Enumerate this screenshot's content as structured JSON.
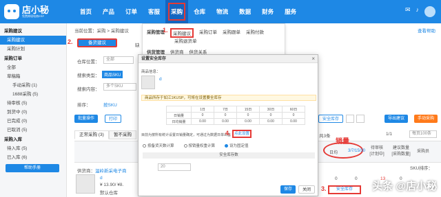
{
  "app": {
    "name": "店小秘",
    "subtitle": "免费跨境电商ERP"
  },
  "nav": [
    "首页",
    "产品",
    "订单",
    "客服",
    "采购",
    "仓库",
    "物流",
    "数据",
    "财务",
    "服务"
  ],
  "sidebar": {
    "groups": [
      {
        "title": "采购建议",
        "items": [
          "采购建议",
          "采购计划"
        ]
      },
      {
        "title": "采购订单",
        "items": [
          "全部",
          "草稿箱",
          "手动采购 (1)",
          "1688采购 (5)",
          "待审核 (5)",
          "到货中 (0)",
          "已完成 (0)",
          "已取消 (5)"
        ]
      },
      {
        "title": "采购入库",
        "items": [
          "待入库 (5)",
          "已入库 (6)"
        ]
      }
    ],
    "help_button": "帮助手册"
  },
  "breadcrumb": "当前位置：采购 > 采购建议",
  "help_link": "查看帮助",
  "purchase_dropdown": {
    "row1": {
      "label": "采购管理",
      "items": [
        "采购建议",
        "采购订单",
        "采购跟单",
        "采购付款"
      ]
    },
    "row1b": "采购退货单",
    "row2": {
      "label": "供货管理",
      "items": [
        "供货商",
        "供货关系"
      ]
    }
  },
  "filters": {
    "tab_active": "备货建议",
    "tab_other": "缺",
    "warehouse_label": "仓库位置：",
    "warehouse_value": "全部",
    "search_type_label": "搜索类型：",
    "search_type_value": "商品SKU",
    "search_content_label": "搜索内容：",
    "search_placeholder": "多个SKU",
    "sort_label": "排序：",
    "sort_value": "按SKU"
  },
  "toolbar": {
    "batch": "批量操作",
    "print": "打印",
    "safety_stock": "安全库存",
    "export": "导出建议",
    "manual_purchase": "手动采购",
    "pager": "共3条",
    "page": "1/1",
    "per_page": "每页100条"
  },
  "list_tabs": [
    "正常采购 (3)",
    "暂不采购"
  ],
  "columns": [
    "日均",
    "待审核\n[计划中]",
    "建议数量\n[采购数量]",
    "采购员"
  ],
  "cell_daily": "3/7/15/30",
  "sku_sort_hint": "SKU排序：",
  "row": {
    "supplier": "供货商：",
    "shop": "温岭新采电子商",
    "title": "d",
    "price": "¥ 13.90/ ¥8.",
    "default_warehouse": "默认仓库",
    "values": [
      "0",
      "0",
      "13",
      "0"
    ]
  },
  "modal": {
    "title": "设置安全库存",
    "product_label": "商品信息：",
    "product_sku": "d",
    "info": "商品所存于如江1KUSP，可将在设置要全库存",
    "table_cols": [
      "1日",
      "7日",
      "15日",
      "30日",
      "60日"
    ],
    "table_rows": [
      {
        "label": "日销量",
        "values": [
          "0",
          "0",
          "0",
          "0",
          "0"
        ]
      },
      {
        "label": "日均销量",
        "values": [
          "0.00",
          "0.00",
          "0.00",
          "0.00",
          "0.00"
        ]
      }
    ],
    "hint": "目前为按所有统计设置日销量确定，可通过为数据日单出售量计算量",
    "link": "点此设置",
    "radios": [
      "按备货天数计算",
      "按销量权重计算",
      "设为固定值"
    ],
    "radio_selected_index": 2,
    "stock_header": "安全库存数",
    "stock_value": "20",
    "save": "保存",
    "cancel": "关闭"
  },
  "row_safety_button": "安全库存",
  "annotations": {
    "a1": "1.",
    "a2": "2.",
    "a3": "3.",
    "a4": "4.",
    "sales_word": "销量"
  },
  "watermark": "头条 @店小秘",
  "colors": {
    "brand": "#1e88e5",
    "annotation": "#e53935",
    "orange": "#ff7a1a"
  }
}
